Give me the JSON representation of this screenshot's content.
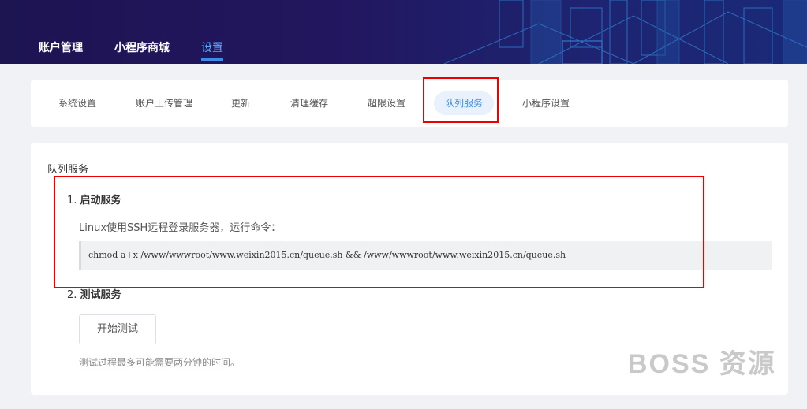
{
  "topnav": {
    "items": [
      {
        "label": "账户管理"
      },
      {
        "label": "小程序商城"
      },
      {
        "label": "设置"
      }
    ]
  },
  "tabs": [
    {
      "label": "系统设置"
    },
    {
      "label": "账户上传管理"
    },
    {
      "label": "更新"
    },
    {
      "label": "清理缓存"
    },
    {
      "label": "超限设置"
    },
    {
      "label": "队列服务"
    },
    {
      "label": "小程序设置"
    }
  ],
  "main": {
    "title": "队列服务",
    "step1": {
      "number": "1.",
      "title": "启动服务"
    },
    "desc": "Linux使用SSH远程登录服务器，运行命令：",
    "command": "chmod a+x /www/wwwroot/www.weixin2015.cn/queue.sh && /www/wwwroot/www.weixin2015.cn/queue.sh",
    "step2": {
      "number": "2.",
      "title": "测试服务"
    },
    "test_button": "开始测试",
    "note": "测试过程最多可能需要两分钟的时间。"
  },
  "watermark": "BOSS 资源",
  "colors": {
    "accent": "#3a8ee6",
    "highlight": "#e00000",
    "header": "#1d1452"
  }
}
